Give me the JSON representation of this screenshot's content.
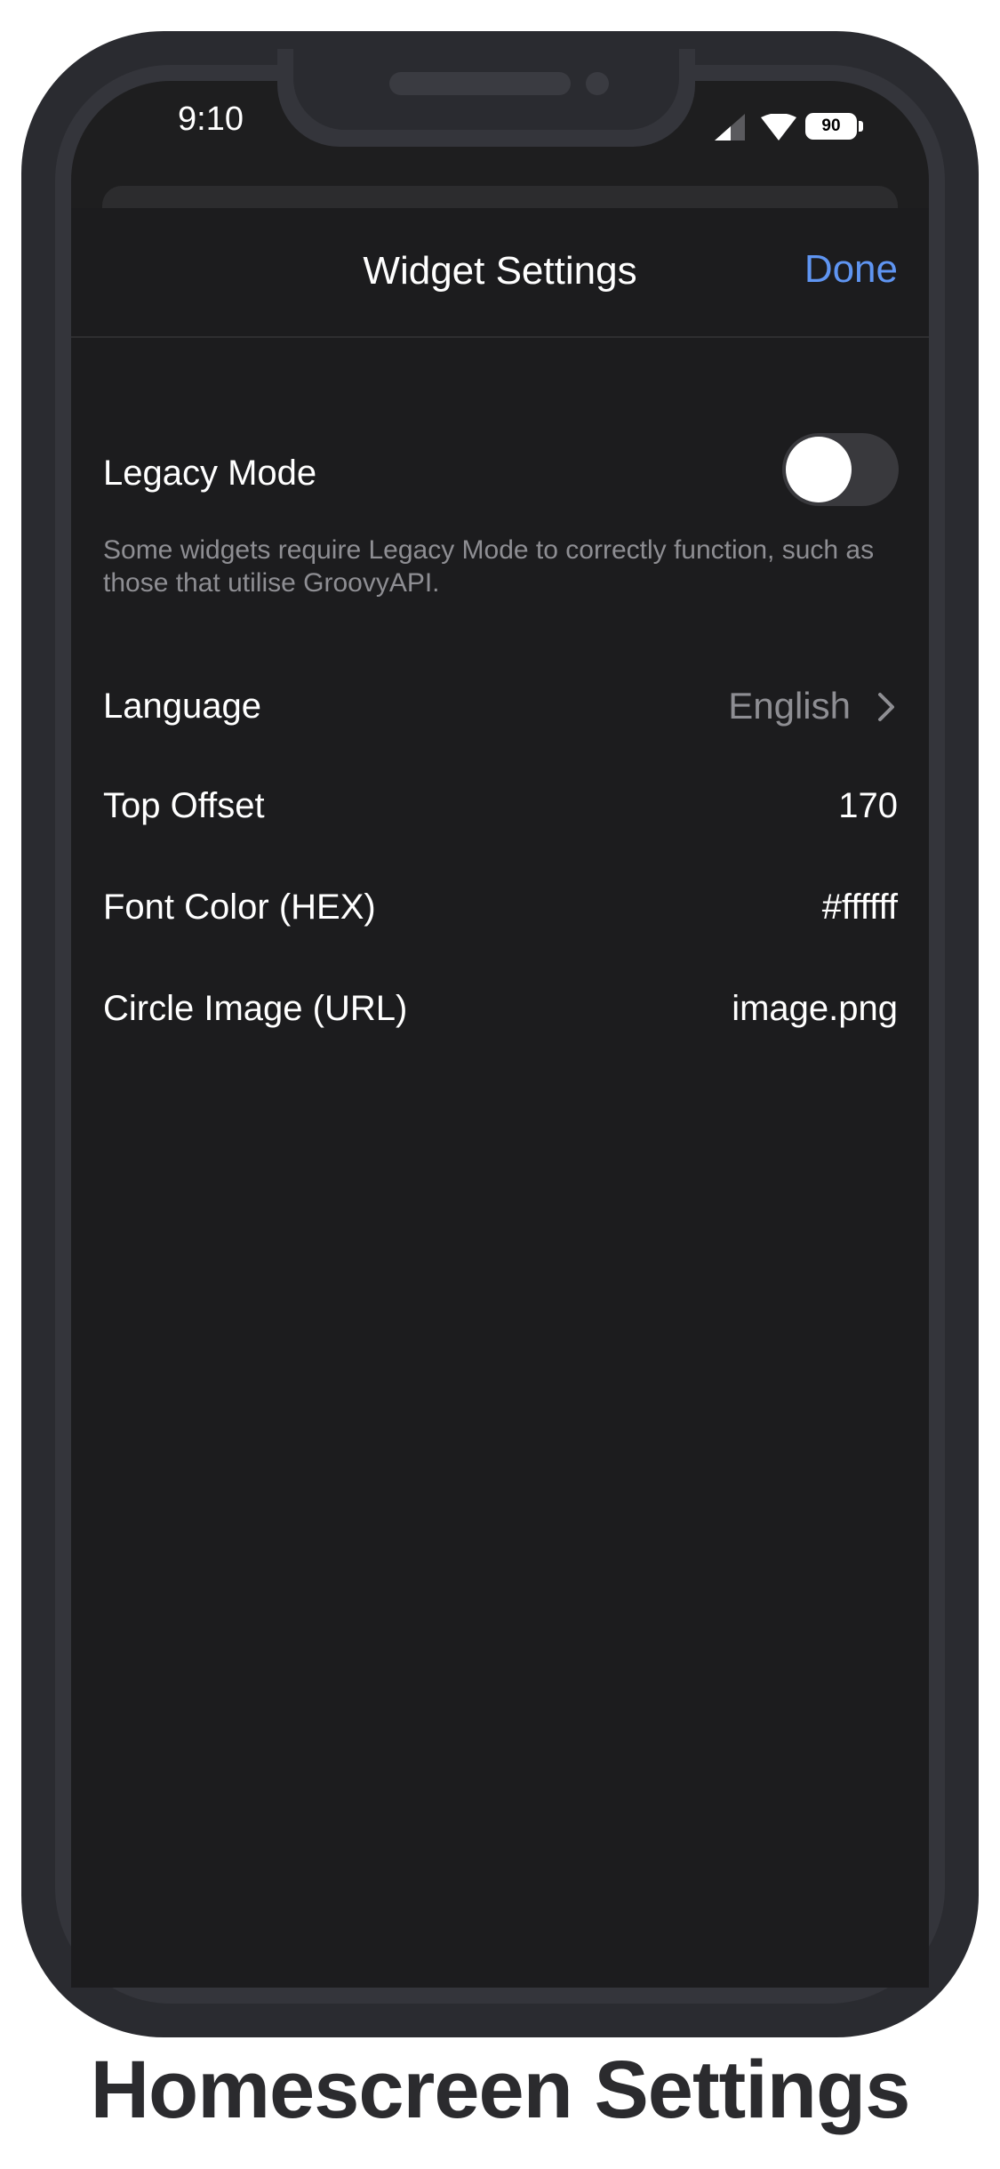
{
  "status_bar": {
    "time": "9:10",
    "battery": "90",
    "icons": [
      "cellular-signal-icon",
      "wifi-icon",
      "battery-icon"
    ]
  },
  "nav": {
    "title": "Widget Settings",
    "done_label": "Done"
  },
  "settings": {
    "legacy_mode": {
      "label": "Legacy Mode",
      "enabled": false,
      "footnote": "Some widgets require Legacy Mode to correctly function, such as those that utilise GroovyAPI."
    },
    "language": {
      "label": "Language",
      "value": "English"
    },
    "top_offset": {
      "label": "Top Offset",
      "value": "170"
    },
    "font_color": {
      "label": "Font Color (HEX)",
      "value": "#ffffff"
    },
    "circle_image": {
      "label": "Circle Image (URL)",
      "value": "image.png"
    }
  },
  "caption": "Homescreen Settings",
  "colors": {
    "accent": "#5f95f2",
    "background": "#1c1c1e",
    "secondary_text": "#8e8e93",
    "toggle_off": "#39393d"
  }
}
